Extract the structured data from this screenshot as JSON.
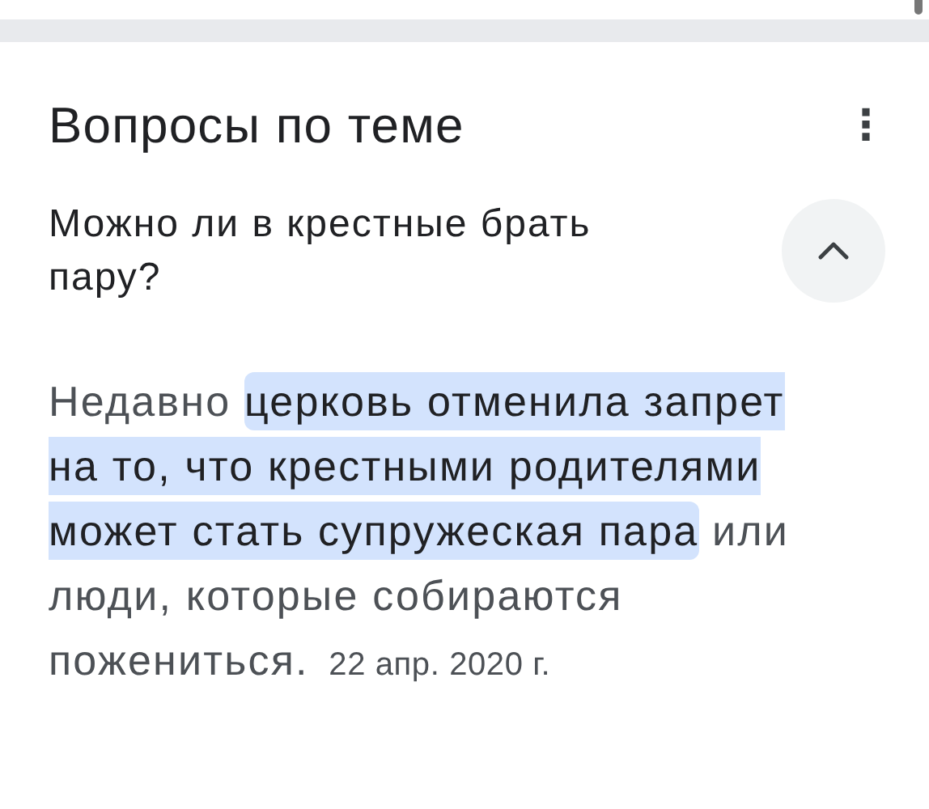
{
  "section": {
    "title": "Вопросы по теме",
    "menu_icon": "⋮"
  },
  "question": {
    "text": "Можно ли в крестные брать пару?",
    "expanded": true
  },
  "answer": {
    "before": "Недавно ",
    "highlight": "церковь отменила запрет на то, что крестными родителями может стать супружеская пара",
    "after": " или люди, которые собираются пожениться.",
    "date": "22 апр. 2020 г."
  }
}
